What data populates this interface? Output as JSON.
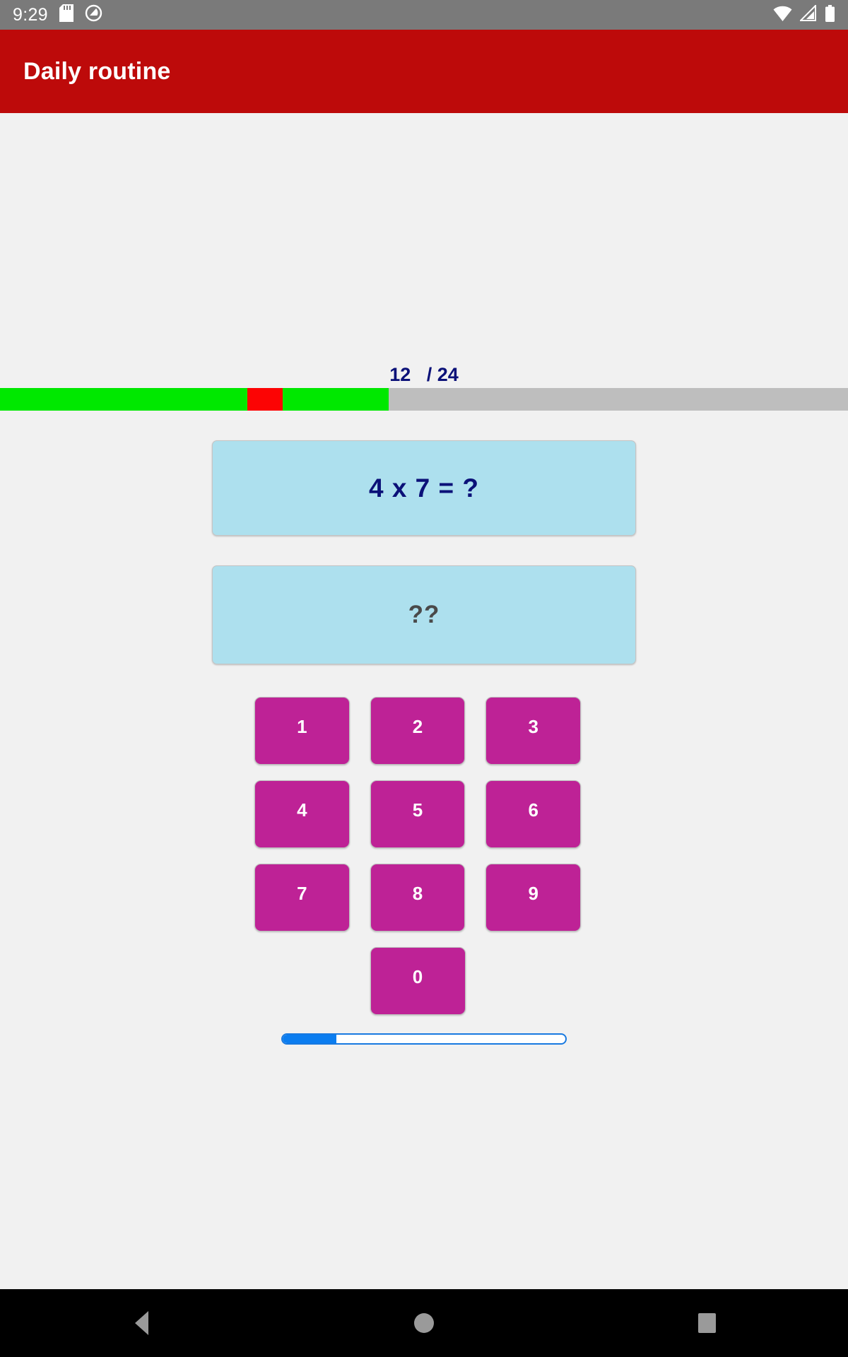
{
  "status_bar": {
    "clock": "9:29",
    "left_icons": [
      "sd-card-icon",
      "do-not-disturb-icon"
    ],
    "right_icons": [
      "wifi-icon",
      "cell-signal-icon",
      "battery-icon"
    ],
    "background_color": "#7a7a7a"
  },
  "app_bar": {
    "title": "Daily routine",
    "background_color": "#bd0a0a",
    "text_color": "#ffffff"
  },
  "progress": {
    "current": "12",
    "total": "24",
    "counter_label": "12   / 24",
    "correct_color": "#00e800",
    "wrong_color": "#fc0404",
    "remaining_color": "#bebebe",
    "segments": [
      {
        "result": "correct",
        "weight": 7
      },
      {
        "result": "wrong",
        "weight": 1
      },
      {
        "result": "correct",
        "weight": 3
      },
      {
        "result": "remaining",
        "weight": 13
      }
    ]
  },
  "question": {
    "text": "4 x 7 = ?",
    "operand_a": "4",
    "operator": "x",
    "operand_b": "7",
    "card_color": "#ade0ee",
    "text_color": "#0b1178"
  },
  "answer": {
    "text": "??",
    "card_color": "#ade0ee",
    "text_color": "#4a4a4a"
  },
  "keypad": {
    "key_color": "#be2296",
    "key_text_color": "#ffffff",
    "rows": [
      [
        "1",
        "2",
        "3"
      ],
      [
        "4",
        "5",
        "6"
      ],
      [
        "7",
        "8",
        "9"
      ],
      [
        "0"
      ]
    ]
  },
  "timer": {
    "fill_percent": 19,
    "fill_color": "#0b7df0",
    "track_color": "#ffffff",
    "border_color": "#1879e0"
  },
  "nav_bar": {
    "buttons": [
      "back-button",
      "home-button",
      "recents-button"
    ],
    "icon_color": "#9a9a9a",
    "background_color": "#000000"
  }
}
